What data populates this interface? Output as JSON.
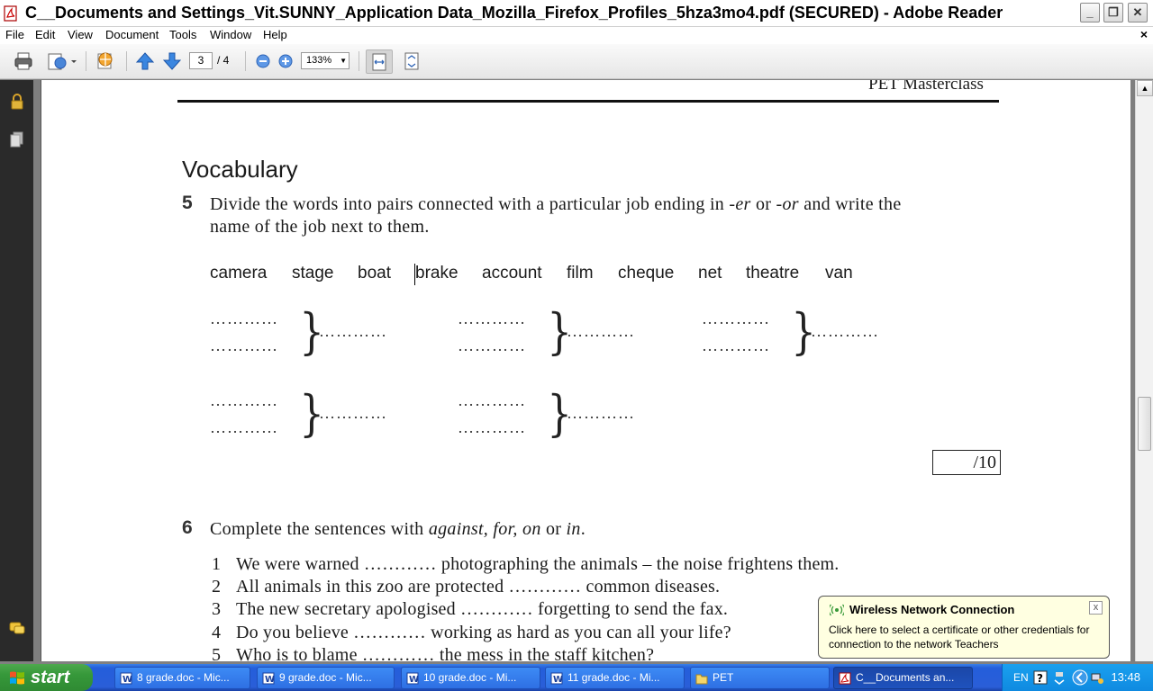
{
  "window": {
    "title": "C__Documents and Settings_Vit.SUNNY_Application Data_Mozilla_Firefox_Profiles_5hza3mo4.pdf (SECURED) - Adobe Reader",
    "minimize_label": "_",
    "maximize_label": "❐",
    "close_label": "✕"
  },
  "menu": {
    "file": "File",
    "edit": "Edit",
    "view": "View",
    "document": "Document",
    "tools": "Tools",
    "window": "Window",
    "help": "Help",
    "close_doc": "×"
  },
  "toolbar": {
    "current_page": "3",
    "page_total": "/ 4",
    "zoom": "133%"
  },
  "document": {
    "header": "PET Masterclass",
    "section_title": "Vocabulary",
    "q5_number": "5",
    "q5_text_line1": "Divide the words into pairs connected with a particular job ending in",
    "q5_er": "-er",
    "q5_or_word": "or",
    "q5_or": "-or",
    "q5_text_tail": "and write the",
    "q5_text_line2": "name of the job next to them.",
    "words": [
      "camera",
      "stage",
      "boat",
      "brake",
      "account",
      "film",
      "cheque",
      "net",
      "theatre",
      "van"
    ],
    "dots": "…………",
    "brace": "}",
    "score": "/10",
    "q6_number": "6",
    "q6_text_pre": "Complete the sentences with",
    "q6_options": "against, for, on",
    "q6_or": "or",
    "q6_in": "in",
    "q6_end": ".",
    "sentences": [
      {
        "n": "1",
        "text": "We were warned ………… photographing the animals – the noise frightens them."
      },
      {
        "n": "2",
        "text": "All animals in this zoo are protected ………… common diseases."
      },
      {
        "n": "3",
        "text": "The new secretary apologised ………… forgetting to send the fax."
      },
      {
        "n": "4",
        "text": "Do you believe ………… working as hard as you can all your life?"
      },
      {
        "n": "5",
        "text": "Who is to blame ………… the mess in the staff kitchen?"
      }
    ]
  },
  "balloon": {
    "title": "Wireless Network Connection",
    "text": "Click here to select a certificate or other credentials for connection to the network Teachers",
    "close": "x"
  },
  "taskbar": {
    "start": "start",
    "tasks": [
      {
        "label": "8 grade.doc - Mic...",
        "icon": "word-doc-icon"
      },
      {
        "label": "9 grade.doc - Mic...",
        "icon": "word-doc-icon"
      },
      {
        "label": "10 grade.doc - Mi...",
        "icon": "word-doc-icon"
      },
      {
        "label": "11 grade.doc - Mi...",
        "icon": "word-doc-icon"
      },
      {
        "label": "PET",
        "icon": "folder-icon"
      },
      {
        "label": "C__Documents an...",
        "icon": "pdf-icon"
      }
    ],
    "lang": "EN",
    "clock": "13:48"
  }
}
